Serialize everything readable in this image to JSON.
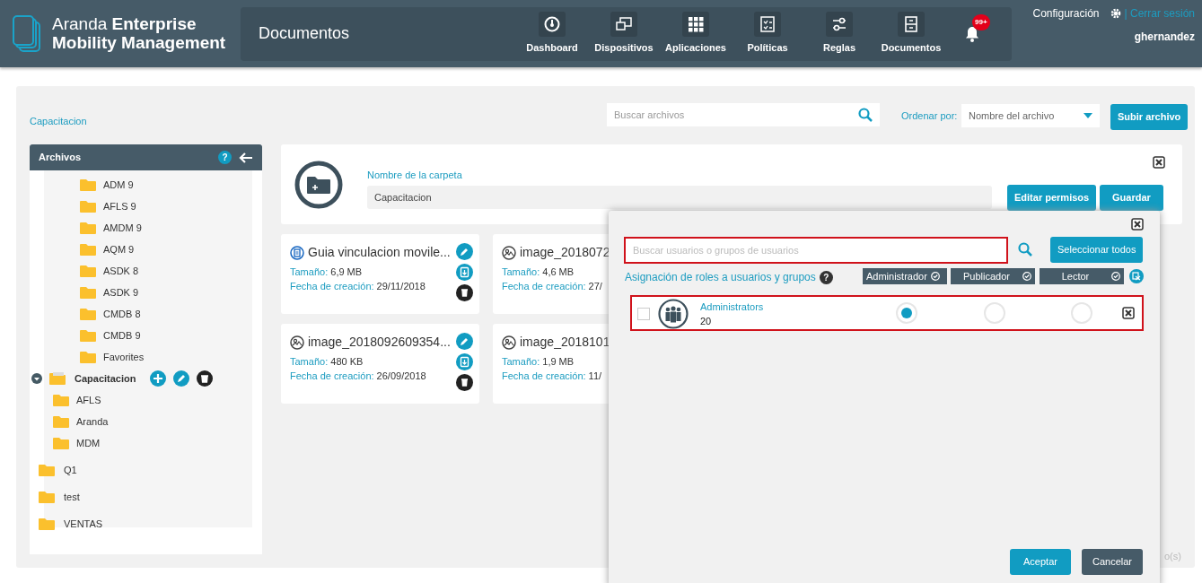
{
  "header": {
    "brand_light": "Aranda",
    "brand_bold": "Enterprise",
    "brand_line2": "Mobility Management",
    "page_title": "Documentos",
    "nav": [
      {
        "label": "Dashboard"
      },
      {
        "label": "Dispositivos"
      },
      {
        "label": "Aplicaciones"
      },
      {
        "label": "Políticas"
      },
      {
        "label": "Reglas"
      },
      {
        "label": "Documentos"
      }
    ],
    "notifications": "99+",
    "settings": "Configuración",
    "logout": "| Cerrar sesión",
    "user": "ghernandez"
  },
  "breadcrumb": "Capacitacion",
  "toolbar": {
    "search_placeholder": "Buscar archivos",
    "sort_label": "Ordenar por:",
    "sort_value": "Nombre del archivo",
    "upload": "Subir archivo"
  },
  "tree": {
    "title": "Archivos",
    "help": "?",
    "scrolled_children": [
      {
        "label": "ADM 9"
      },
      {
        "label": "AFLS 9"
      },
      {
        "label": "AMDM 9"
      },
      {
        "label": "AQM 9"
      },
      {
        "label": "ASDK 8"
      },
      {
        "label": "ASDK 9"
      },
      {
        "label": "CMDB 8"
      },
      {
        "label": "CMDB 9"
      },
      {
        "label": "Favorites"
      }
    ],
    "items": [
      {
        "label": "Capacitacion",
        "selected": true,
        "expanded": true,
        "children": [
          {
            "label": "AFLS",
            "selected": false
          },
          {
            "label": "Aranda",
            "selected": false
          },
          {
            "label": "MDM",
            "selected": false
          }
        ]
      },
      {
        "label": "Q1",
        "selected": false
      },
      {
        "label": "test",
        "selected": false
      },
      {
        "label": "VENTAS",
        "selected": false
      }
    ]
  },
  "folder": {
    "label": "Nombre de la carpeta",
    "value": "Capacitacion",
    "edit_permissions": "Editar permisos",
    "save": "Guardar"
  },
  "files": [
    {
      "kind": "document",
      "name": "Guia vinculacion movile...",
      "size_label": "Tamaño:",
      "size": "6,9 MB",
      "date_label": "Fecha de creación:",
      "date": "29/11/2018"
    },
    {
      "kind": "image",
      "name": "image_2018072",
      "size_label": "Tamaño:",
      "size": "4,6 MB",
      "date_label": "Fecha de creación:",
      "date": "27/"
    },
    {
      "kind": "image",
      "name": "image_2018092609354...",
      "size_label": "Tamaño:",
      "size": "480 KB",
      "date_label": "Fecha de creación:",
      "date": "26/09/2018"
    },
    {
      "kind": "image",
      "name": "image_2018101",
      "size_label": "Tamaño:",
      "size": "1,9 MB",
      "date_label": "Fecha de creación:",
      "date": "11/"
    }
  ],
  "footer_fragment": "o(s)",
  "permissions_dialog": {
    "search_placeholder": "Buscar usuarios o grupos de usuarios",
    "select_all": "Seleccionar todos",
    "heading": "Asignación de roles a usuarios y grupos",
    "help": "?",
    "roles": [
      {
        "label": "Administrador"
      },
      {
        "label": "Publicador"
      },
      {
        "label": "Lector"
      }
    ],
    "rows": [
      {
        "name": "Administrators",
        "count": "20",
        "checked": false,
        "roles": [
          {
            "selected": true
          },
          {
            "selected": false
          },
          {
            "selected": false
          }
        ]
      }
    ],
    "accept": "Aceptar",
    "cancel": "Cancelar"
  }
}
